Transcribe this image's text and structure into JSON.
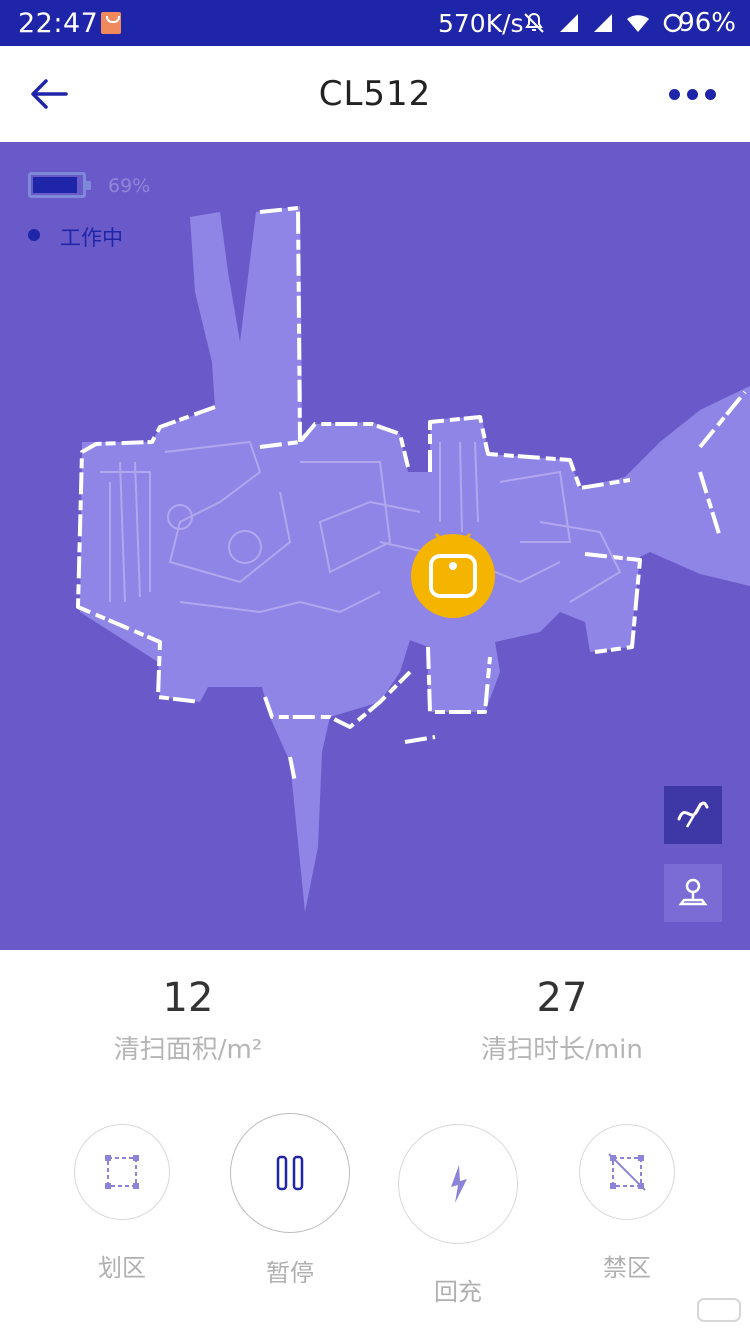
{
  "status_bar": {
    "time": "22:47",
    "net_speed": "570K/s",
    "battery_percent": "96%"
  },
  "header": {
    "title": "CL512"
  },
  "robot": {
    "battery_level": 69,
    "battery_text": "69%",
    "state": "工作中"
  },
  "stats": {
    "area_value": "12",
    "area_label": "清扫面积/m²",
    "time_value": "27",
    "time_label": "清扫时长/min"
  },
  "controls": {
    "zone_label": "划区",
    "pause_label": "暂停",
    "dock_label": "回充",
    "forbid_label": "禁区"
  },
  "colors": {
    "brand": "#1f25a8",
    "map_bg": "#6a5ac9",
    "map_floor": "#8f85e6",
    "robot": "#f5b400"
  }
}
